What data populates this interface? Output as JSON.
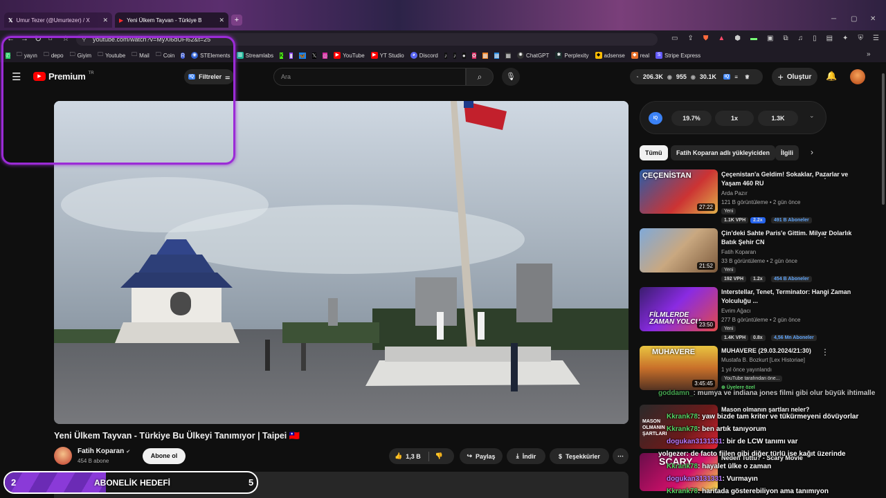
{
  "tabs": [
    {
      "label": "Umur Tezer (@Umurtezer) / X"
    },
    {
      "label": "Yeni Ülkem Tayvan - Türkiye B"
    }
  ],
  "address": {
    "url": "youtube.com/watch?v=MyXi6dUFl62&t=25"
  },
  "bookmarks": [
    "yayın",
    "depo",
    "Giyim",
    "Youtube",
    "Mail",
    "Coin",
    "STElements",
    "Streamlabs",
    "YouTube",
    "YT Studio",
    "Discord",
    "ChatGPT",
    "Perplexity",
    "adsense",
    "real",
    "Stripe Express"
  ],
  "header": {
    "logo": "Premium",
    "region": "TR",
    "filters_label": "Filtreler",
    "search_placeholder": "Ara",
    "stats": [
      "206.3K",
      "955",
      "30.1K"
    ],
    "create_label": "Oluştur"
  },
  "ext_panel": {
    "tag": "IQ",
    "values": [
      "19.7%",
      "1x",
      "1.3K"
    ]
  },
  "chips": [
    "Tümü",
    "Fatih Koparan adlı yükleyiciden",
    "İlgili"
  ],
  "video": {
    "title": "Yeni Ülkem Tayvan - Türkiye Bu Ülkeyi Tanımıyor | Taipei 🇹🇼",
    "channel": "Fatih Koparan",
    "subs": "454 B abone",
    "subscribe_label": "Abone ol",
    "likes": "1,3 B",
    "share_label": "Paylaş",
    "download_label": "İndir",
    "thanks_label": "Teşekkürler"
  },
  "recommendations": [
    {
      "title": "Çeçenistan'a Geldim! Sokaklar, Pazarlar ve Yaşam 460 RU",
      "channel": "Arda Pazır",
      "meta": "121 B görüntüleme • 2 gün önce",
      "tag": "Yeni",
      "duration": "27:22",
      "thumb_text": "ÇEÇENİSTAN",
      "vph": "1.1K VPH",
      "mult": "2.2x",
      "subs": "491 B Aboneler",
      "mult_color": "#2563eb"
    },
    {
      "title": "Çin'deki Sahte Paris'e Gittim. Milyar Dolarlık Batık Şehir CN",
      "channel": "Fatih Koparan",
      "meta": "33 B görüntüleme • 2 gün önce",
      "tag": "Yeni",
      "duration": "21:52",
      "thumb_text": "",
      "vph": "192 VPH",
      "mult": "1.2x",
      "subs": "454 B Aboneler",
      "mult_color": "#3a3a3a"
    },
    {
      "title": "Interstellar, Tenet, Terminator: Hangi Zaman Yolculuğu ...",
      "channel": "Evrim Ağacı",
      "meta": "277 B görüntüleme • 2 gün önce",
      "tag": "Yeni",
      "duration": "23:50",
      "thumb_text": "FİLMLERDE ZAMAN YOLCU",
      "vph": "1.4K VPH",
      "mult": "0.8x",
      "subs": "4,56 Mn Aboneler",
      "mult_color": "#3a3a3a"
    },
    {
      "title": "MUHAVERE (29.03.2024/21:30)",
      "channel": "Mustafa B. Bozkurt [Lex Historiae]",
      "meta": "1 yıl önce yayınlandı",
      "tag": "YouTube tarafından öne...",
      "duration": "3:45:45",
      "thumb_text": "MUHAVERE",
      "members": "Üyelere özel"
    },
    {
      "title": "Mason olmanın şartları neler?",
      "channel": "",
      "meta": "",
      "thumb_text": "MASON OLMANIN ŞARTLARI"
    },
    {
      "title": "Neden Tuttu? - Scary Movie",
      "channel": "",
      "meta": "",
      "thumb_text": "SCARY"
    }
  ],
  "chat": [
    {
      "user": "goddamn_",
      "msg": ": mumya ve indiana jones filmi gibi olur büyük ihtimalle"
    },
    {
      "user": "Kkrank78",
      "msg": ": yaw bizde tam kriter ve tükürmeyeni dövüyorlar"
    },
    {
      "user": "Kkrank78",
      "msg": ": ben artık tanıyorum"
    },
    {
      "user": "dogukan3131331",
      "msg": ": bir de LCW tanımı var"
    },
    {
      "user": "yolgezer",
      "msg": ": de facto fiilen gibi diğer türlü ise kağıt üzerinde"
    },
    {
      "user": "Kkrank78",
      "msg": ": hayalet ülke o zaman"
    },
    {
      "user": "dogukan3131331",
      "msg": ": Vurmayın"
    },
    {
      "user": "Kkrank78",
      "msg": ": haritada gösterebiliyon ama tanımıyon"
    }
  ],
  "goal": {
    "current": "2",
    "label": "ABONELİK HEDEFİ",
    "target": "5",
    "progress": 0.4
  }
}
